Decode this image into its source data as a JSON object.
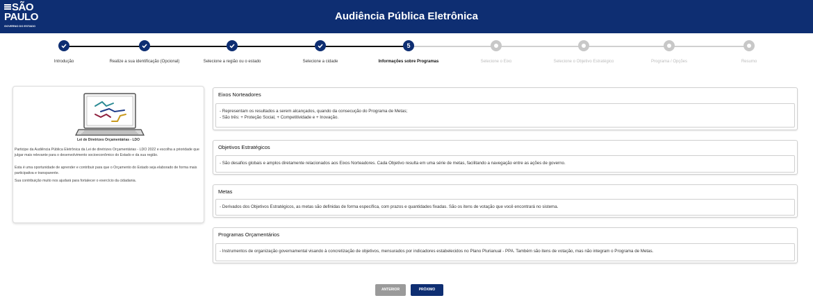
{
  "header": {
    "logo_line1": "SÃO",
    "logo_line2": "PAULO",
    "logo_sub": "GOVERNO DO ESTADO",
    "title": "Audiência Pública Eletrônica",
    "background": "#0e2e72"
  },
  "stepper": {
    "current_step": 5,
    "steps": [
      {
        "label": "Introdução",
        "state": "done"
      },
      {
        "label": "Realize a sua identificação (Opcional)",
        "state": "done"
      },
      {
        "label": "Selecione a região ou o estado",
        "state": "done"
      },
      {
        "label": "Selecione a cidade",
        "state": "done"
      },
      {
        "label": "Informações sobre Programas",
        "state": "current",
        "number": "5"
      },
      {
        "label": "Selecione o Eixo",
        "state": "future"
      },
      {
        "label": "Selecione o Objetivo Estratégico",
        "state": "future"
      },
      {
        "label": "Programa / Opções",
        "state": "future"
      },
      {
        "label": "Resumo",
        "state": "future"
      }
    ]
  },
  "left_card": {
    "caption": "Lei de Diretrizes Orçamentárias - LDO",
    "p1": "Participe da Audiência Pública Eletrônica da Lei de diretrizes Orçamentárias - LDO 2022 e escolha a prioridade que julgar mais relevante para o desenvolvimento socioeconômico do Estado e da sua região.",
    "p2": "Esta é uma oportunidade de aprender e contribuir para que o Orçamento do Estado seja elaborado de forma mais participativa e transparente.",
    "p3": "Sua contribuição muito nos ajudará para fortalecer o exercício da cidadania."
  },
  "sections": [
    {
      "title": "Eixos Norteadores",
      "lines": [
        "- Representam os resultados a serem alcançados, quando da consecução do Programa de Metas;",
        "- São três: + Proteção Social, + Competitividade e + Inovação."
      ]
    },
    {
      "title": "Objetivos Estratégicos",
      "lines": [
        "- São desafios globais e amplos diretamente relacionados aos Eixos Norteadores. Cada Objetivo resulta em uma série de metas, facilitando a navegação entre as ações de governo."
      ]
    },
    {
      "title": "Metas",
      "lines": [
        "- Derivados dos Objetivos Estratégicos, as metas são definidas de forma específica, com prazos e quantidades fixadas. São os itens de votação que você encontrará no sistema."
      ]
    },
    {
      "title": "Programas Orçamentários",
      "lines": [
        "- Instrumentos de organização governamental visando à concretização de objetivos, mensurados por indicadores estabelecidos no Plano Plurianual - PPA. Também são itens de votação, mas não integram o Programa de Metas."
      ]
    }
  ],
  "buttons": {
    "prev": "ANTERIOR",
    "next": "PRÓXIMO"
  }
}
